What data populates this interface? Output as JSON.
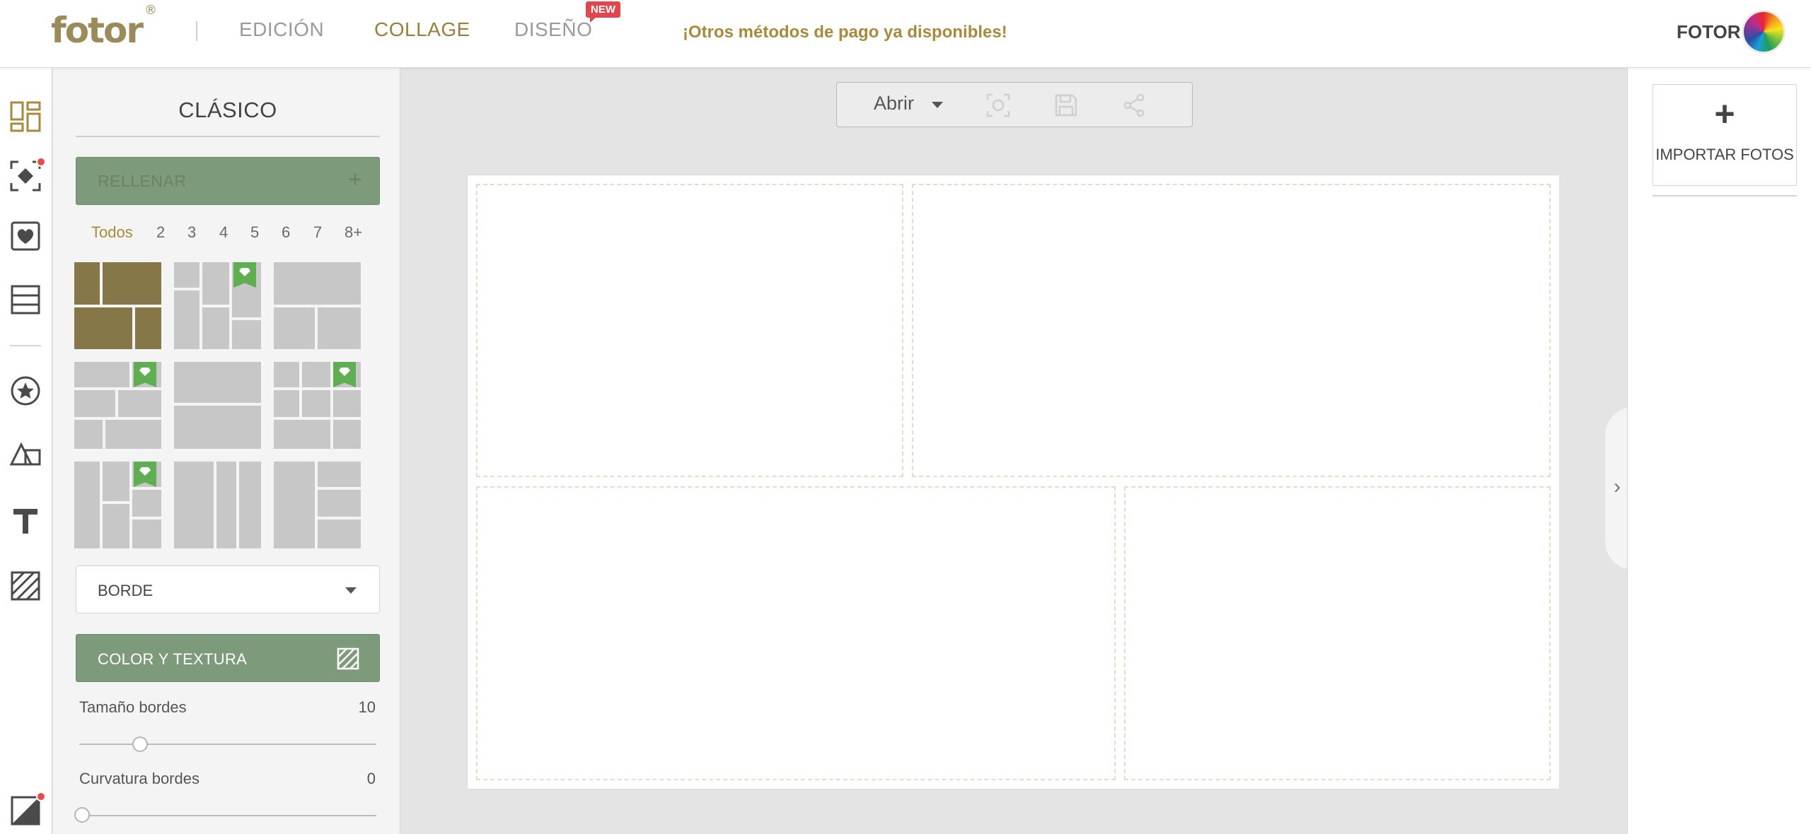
{
  "header": {
    "logo": "fotor",
    "logo_mark": "®",
    "nav": [
      {
        "label": "EDICIÓN"
      },
      {
        "label": "COLLAGE"
      },
      {
        "label": "DISEÑO"
      }
    ],
    "new_badge": "NEW",
    "promo": "¡Otros métodos de pago ya disponibles!",
    "account_label": "FOTOR",
    "active_nav": "COLLAGE"
  },
  "sidebar_icons": [
    "layout-icon",
    "stitch-icon",
    "sticker-heart-icon",
    "rows-icon",
    "star-icon",
    "shapes-icon",
    "text-icon",
    "texture-icon",
    "background-icon"
  ],
  "panel": {
    "title": "CLÁSICO",
    "fill_label": "RELLENAR",
    "fill_plus": "+",
    "filters": [
      "Todos",
      "2",
      "3",
      "4",
      "5",
      "6",
      "7",
      "8+"
    ],
    "active_filter": "Todos",
    "border_label": "BORDE",
    "color_texture_label": "COLOR Y TEXTURA",
    "border_size": {
      "label": "Tamaño bordes",
      "value": "10",
      "fraction": 0.2
    },
    "border_curve": {
      "label": "Curvatura bordes",
      "value": "0",
      "fraction": 0.0
    }
  },
  "toolbar": {
    "open_label": "Abrir"
  },
  "right_panel": {
    "import_plus": "+",
    "import_label": "IMPORTAR FOTOS"
  },
  "colors": {
    "accent_gold": "#a88a3d",
    "button_green": "#7d9b7b",
    "badge_red": "#e0464d",
    "premium_green": "#5fae52"
  }
}
